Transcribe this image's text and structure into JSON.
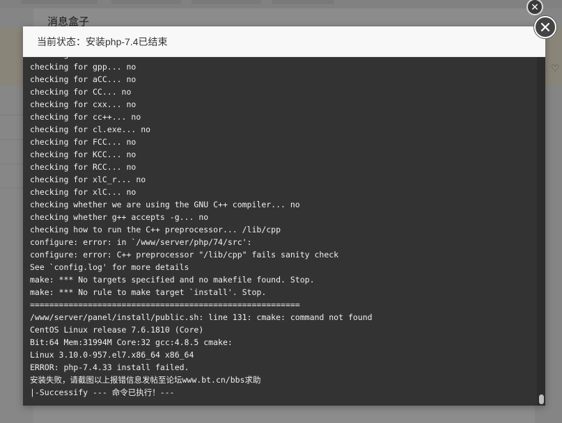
{
  "background": {
    "panel_title": "消息盒子"
  },
  "dialog": {
    "status_label": "当前状态：",
    "status_value": "安装php-7.4已结束",
    "console_lines": [
      "checking for c++... no",
      "checking for gpp... no",
      "checking for aCC... no",
      "checking for CC... no",
      "checking for cxx... no",
      "checking for cc++... no",
      "checking for cl.exe... no",
      "checking for FCC... no",
      "checking for KCC... no",
      "checking for RCC... no",
      "checking for xlC_r... no",
      "checking for xlC... no",
      "checking whether we are using the GNU C++ compiler... no",
      "checking whether g++ accepts -g... no",
      "checking how to run the C++ preprocessor... /lib/cpp",
      "configure: error: in `/www/server/php/74/src':",
      "configure: error: C++ preprocessor \"/lib/cpp\" fails sanity check",
      "See `config.log' for more details",
      "make: *** No targets specified and no makefile found. Stop.",
      "make: *** No rule to make target `install'. Stop.",
      "========================================================",
      "/www/server/panel/install/public.sh: line 131: cmake: command not found",
      "CentOS Linux release 7.6.1810 (Core)",
      "Bit:64 Mem:31994M Core:32 gcc:4.8.5 cmake:",
      "Linux 3.10.0-957.el7.x86_64 x86_64",
      "ERROR: php-7.4.33 install failed.",
      "安装失败，请截图以上报错信息发帖至论坛www.bt.cn/bbs求助",
      "|-Successify --- 命令已执行！---"
    ]
  },
  "icons": {
    "close": "close-icon",
    "background_close": "close-icon",
    "heart": "heart-icon"
  }
}
